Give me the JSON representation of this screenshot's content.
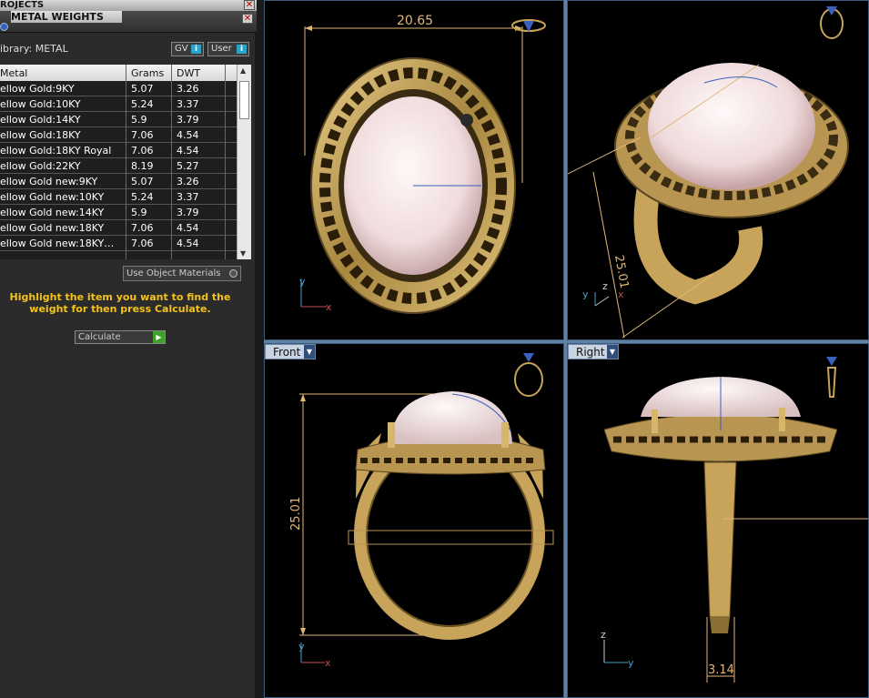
{
  "left_panel": {
    "projects_tab": "ROJECTS",
    "metal_tab": "METAL WEIGHTS",
    "library_label": "ibrary: METAL",
    "lib_buttons": [
      "GV",
      "User"
    ],
    "table": {
      "headers": [
        "Metal",
        "Grams",
        "DWT"
      ],
      "rows": [
        [
          "ellow Gold:9KY",
          "5.07",
          "3.26"
        ],
        [
          "ellow Gold:10KY",
          "5.24",
          "3.37"
        ],
        [
          "ellow Gold:14KY",
          "5.9",
          "3.79"
        ],
        [
          "ellow Gold:18KY",
          "7.06",
          "4.54"
        ],
        [
          "ellow Gold:18KY Royal",
          "7.06",
          "4.54"
        ],
        [
          "ellow Gold:22KY",
          "8.19",
          "5.27"
        ],
        [
          "ellow Gold new:9KY",
          "5.07",
          "3.26"
        ],
        [
          "ellow Gold new:10KY",
          "5.24",
          "3.37"
        ],
        [
          "ellow Gold new:14KY",
          "5.9",
          "3.79"
        ],
        [
          "ellow Gold new:18KY",
          "7.06",
          "4.54"
        ],
        [
          "ellow Gold new:18KY…",
          "7.06",
          "4.54"
        ]
      ]
    },
    "use_object_materials": "Use Object Materials",
    "hint": "Highlight the item you want to find the weight for then press Calculate.",
    "calculate_button": "Calculate"
  },
  "viewports": {
    "top_left": {
      "dimension": "20.65",
      "axes": [
        "y",
        "x"
      ]
    },
    "top_right": {
      "dimension": "25.01",
      "axes": [
        "y",
        "z",
        "x"
      ]
    },
    "front": {
      "label": "Front",
      "dimension": "25.01",
      "axes": [
        "y",
        "x"
      ]
    },
    "right": {
      "label": "Right",
      "dimension": "3.14",
      "axes": [
        "z",
        "y"
      ]
    }
  },
  "colors": {
    "gold": "#c8a45a",
    "gold_dark": "#6b5424",
    "stone": "#f2dfe0",
    "dimension_line": "#e0b878",
    "hint_text": "#f5c21b",
    "viewport_border": "#5f7fa3"
  }
}
